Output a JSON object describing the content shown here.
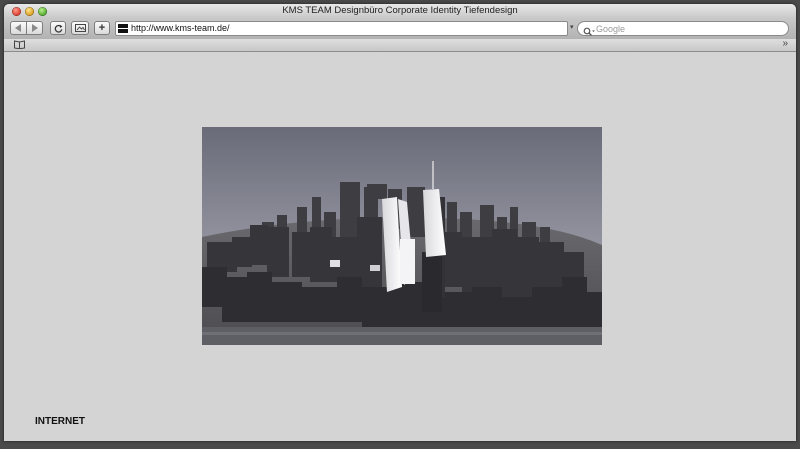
{
  "window": {
    "title": "KMS TEAM Designbüro Corporate Identity Tiefendesign"
  },
  "toolbar": {
    "back_icon": "back-arrow-icon",
    "forward_icon": "forward-arrow-icon",
    "reload_icon": "reload-icon",
    "snapshot_icon": "snapshot-icon",
    "add_icon": "plus-icon",
    "add_label": "+"
  },
  "address_bar": {
    "url": "http://www.kms-team.de/"
  },
  "search": {
    "placeholder": "Google"
  },
  "bookmarks_bar": {
    "bookmarks_icon": "open-book-icon",
    "overflow_label": "»"
  },
  "page": {
    "corner_label": "INTERNET"
  },
  "colors": {
    "window_bg": "#d4d4d4",
    "close": "#d8382a",
    "minimize": "#d89a1c",
    "zoom": "#4ea52a"
  }
}
